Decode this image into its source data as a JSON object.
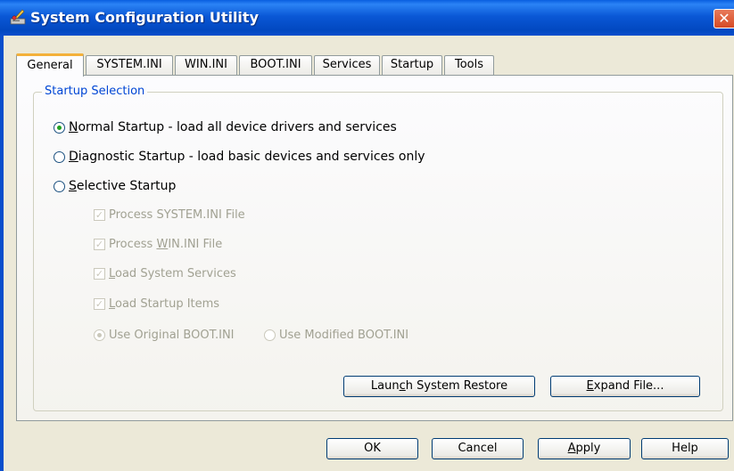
{
  "window": {
    "title": "System Configuration Utility",
    "close_glyph": "✕"
  },
  "tabs": [
    {
      "label": "General",
      "active": true
    },
    {
      "label": "SYSTEM.INI",
      "active": false
    },
    {
      "label": "WIN.INI",
      "active": false
    },
    {
      "label": "BOOT.INI",
      "active": false
    },
    {
      "label": "Services",
      "active": false
    },
    {
      "label": "Startup",
      "active": false
    },
    {
      "label": "Tools",
      "active": false
    }
  ],
  "startup_selection": {
    "legend": "Startup Selection",
    "options": {
      "normal": {
        "mnemonic": "N",
        "rest": "ormal Startup - load all device drivers and services",
        "selected": true
      },
      "diagnostic": {
        "mnemonic": "D",
        "rest": "iagnostic Startup - load basic devices and services only",
        "selected": false
      },
      "selective": {
        "mnemonic": "S",
        "rest": "elective Startup",
        "selected": false
      }
    },
    "selective_items": {
      "system_ini": {
        "label": "Process SYSTEM.INI File",
        "checked": true,
        "enabled": false
      },
      "win_ini": {
        "prefix": "Process ",
        "mnemonic": "W",
        "rest": "IN.INI File",
        "checked": true,
        "enabled": false
      },
      "system_services": {
        "mnemonic": "L",
        "rest": "oad System Services",
        "checked": true,
        "enabled": false
      },
      "startup_items": {
        "mnemonic": "L",
        "rest": "oad Startup Items",
        "checked": true,
        "enabled": false
      },
      "use_original_boot": {
        "label": "Use Original BOOT.INI",
        "selected": true,
        "enabled": false
      },
      "use_modified_boot": {
        "label": "Use Modified BOOT.INI",
        "selected": false,
        "enabled": false
      }
    }
  },
  "buttons": {
    "launch_restore": {
      "pre": "Laun",
      "mnemonic": "c",
      "post": "h System Restore"
    },
    "expand_file": {
      "mnemonic": "E",
      "post": "xpand File..."
    },
    "ok": "OK",
    "cancel": "Cancel",
    "apply": {
      "mnemonic": "A",
      "post": "pply"
    },
    "help": "Help"
  },
  "colors": {
    "titlebar": "#0a58d6",
    "dialog_bg": "#ece9d8",
    "active_tab_accent": "#f3b13b",
    "legend_text": "#0046d5"
  }
}
